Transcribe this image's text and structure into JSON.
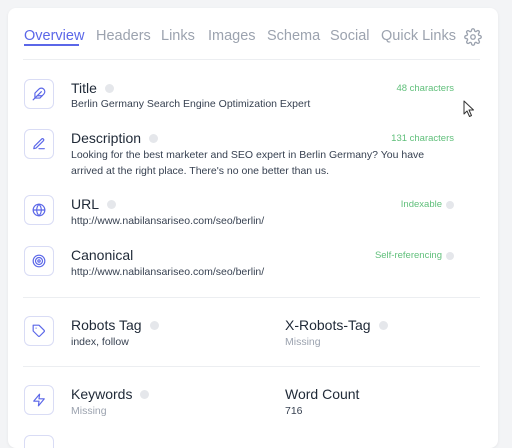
{
  "tabs": [
    {
      "label": "Overview"
    },
    {
      "label": "Headers"
    },
    {
      "label": "Links"
    },
    {
      "label": "Images"
    },
    {
      "label": "Schema"
    },
    {
      "label": "Social"
    },
    {
      "label": "Quick Links"
    }
  ],
  "overview": {
    "title": {
      "label": "Title",
      "value": "Berlin Germany Search Engine Optimization Expert",
      "status": "48 characters",
      "icon": "feather-icon"
    },
    "description": {
      "label": "Description",
      "value_line1": "Looking for the best marketer and SEO expert in Berlin Germany? You have",
      "value_line2": "arrived at the right place. There's no one better than us.",
      "status": "131 characters",
      "icon": "pencil-icon"
    },
    "url": {
      "label": "URL",
      "value": "http://www.nabilansariseo.com/seo/berlin/",
      "status": "Indexable",
      "icon": "globe-icon"
    },
    "canonical": {
      "label": "Canonical",
      "value": "http://www.nabilansariseo.com/seo/berlin/",
      "status": "Self-referencing",
      "icon": "target-icon"
    },
    "robots": {
      "label": "Robots Tag",
      "value": "index, follow",
      "icon": "tag-icon"
    },
    "x_robots": {
      "label": "X-Robots-Tag",
      "value": "Missing"
    },
    "keywords": {
      "label": "Keywords",
      "value": "Missing",
      "icon": "lightning-icon"
    },
    "word_count": {
      "label": "Word Count",
      "value": "716"
    }
  },
  "colors": {
    "accent": "#5b67e8",
    "status_green": "#5fbf7a",
    "muted": "#9ca3af"
  }
}
